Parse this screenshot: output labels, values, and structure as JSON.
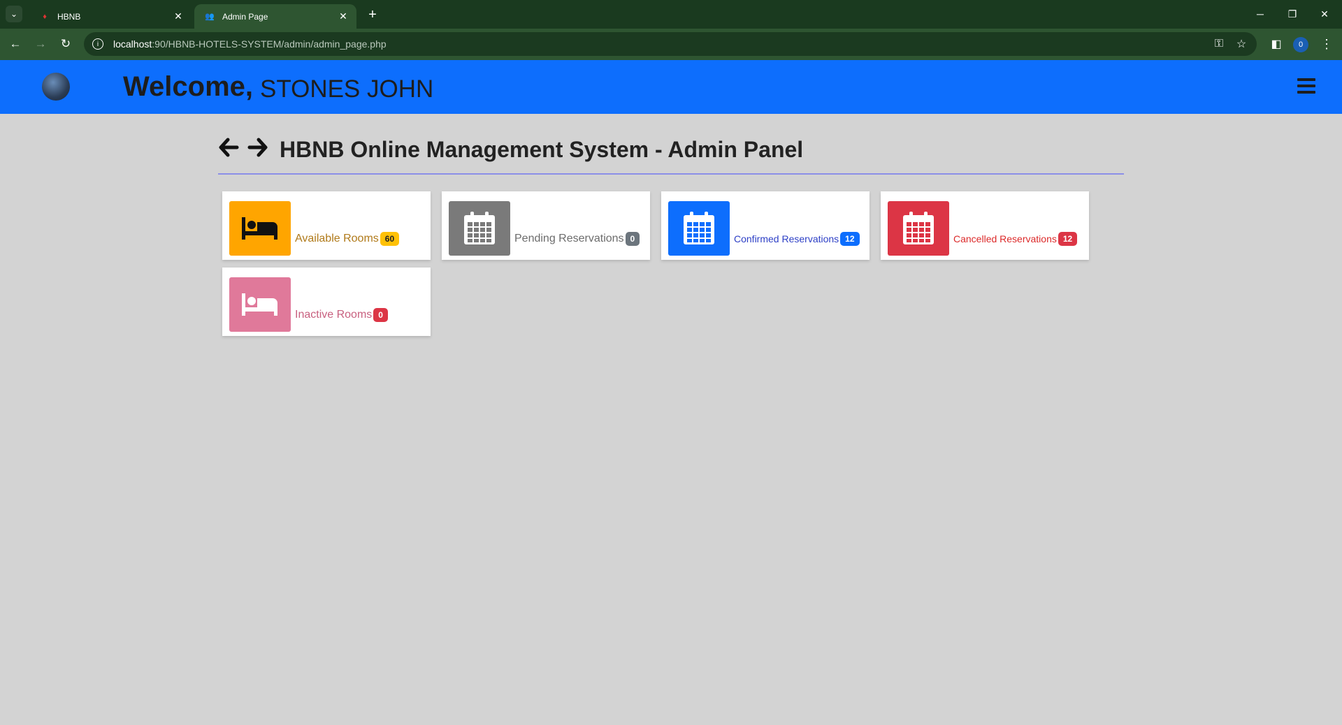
{
  "browser": {
    "tabs": [
      {
        "title": "HBNB"
      },
      {
        "title": "Admin Page"
      }
    ],
    "url_host": "localhost",
    "url_path": ":90/HBNB-HOTELS-SYSTEM/admin/admin_page.php",
    "profile_initial": "0"
  },
  "header": {
    "welcome": "Welcome,",
    "username": "STONES JOHN"
  },
  "panel": {
    "title": "HBNB Online Management System - Admin Panel"
  },
  "cards": [
    {
      "label": "Available Rooms",
      "count": "60",
      "icon": "bed-icon",
      "color": "#ffa500",
      "text_color": "#b07a1a",
      "badge_bg": "#ffc107",
      "badge_fg": "#222"
    },
    {
      "label": "Pending Reservations",
      "count": "0",
      "icon": "calendar-icon",
      "color": "#7a7a7a",
      "text_color": "#6c6c6c",
      "badge_bg": "#6c757d",
      "badge_fg": "#fff"
    },
    {
      "label": "Confirmed Reservations",
      "count": "12",
      "icon": "calendar-icon",
      "color": "#0d6efd",
      "text_color": "#2e40c6",
      "badge_bg": "#0d6efd",
      "badge_fg": "#fff"
    },
    {
      "label": "Cancelled Reservations",
      "count": "12",
      "icon": "calendar-icon",
      "color": "#dc3545",
      "text_color": "#dc2a2a",
      "badge_bg": "#dc3545",
      "badge_fg": "#fff"
    },
    {
      "label": "Inactive Rooms",
      "count": "0",
      "icon": "bed-icon",
      "color": "#e0799a",
      "text_color": "#c8607f",
      "badge_bg": "#dc3545",
      "badge_fg": "#fff"
    }
  ]
}
